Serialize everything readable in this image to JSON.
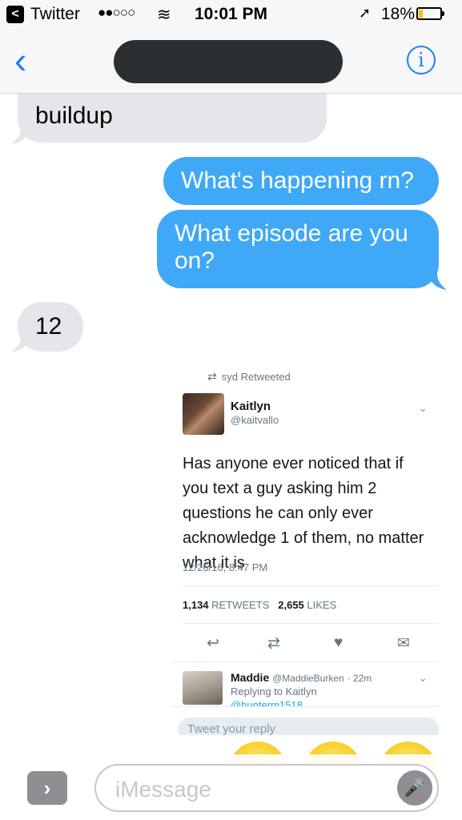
{
  "status_bar": {
    "back_glyph": "<",
    "app": "Twitter",
    "signal": "●●○○○",
    "wifi": "≋",
    "time": "10:01 PM",
    "location": "➚",
    "battery": "18%",
    "battery_level": 0.18
  },
  "nav": {
    "back": "‹",
    "info": "i"
  },
  "messages": [
    {
      "text": "buildup",
      "from": "them"
    },
    {
      "text": "What's happening rn?",
      "from": "me"
    },
    {
      "text": "What episode are you on?",
      "from": "me"
    },
    {
      "text": "12",
      "from": "them"
    }
  ],
  "tweet": {
    "retweet_icon": "⇄",
    "retweeted_by": "syd Retweeted",
    "name": "Kaitlyn",
    "handle": "@kaitvallo",
    "chevron": "⌄",
    "text": "Has anyone ever noticed that if you text a guy asking him 2 questions he can only ever acknowledge 1 of them, no matter what it is",
    "timestamp": "12/26/16, 8:47 PM",
    "retweets_count": "1,134",
    "retweets_label": "RETWEETS",
    "likes_count": "2,655",
    "likes_label": "LIKES",
    "actions": {
      "reply": "↩",
      "retweet": "⇄",
      "like": "♥",
      "dm": "✉"
    },
    "reply": {
      "name": "Maddie",
      "handle": "@MaddieBurken",
      "time": "· 22m",
      "replying_to": "Replying to Kaitlyn",
      "mention": "@hunterm1518"
    },
    "reply_placeholder": "Tweet your reply"
  },
  "input_bar": {
    "expand": "›",
    "placeholder": "iMessage",
    "mic": "🎤"
  }
}
